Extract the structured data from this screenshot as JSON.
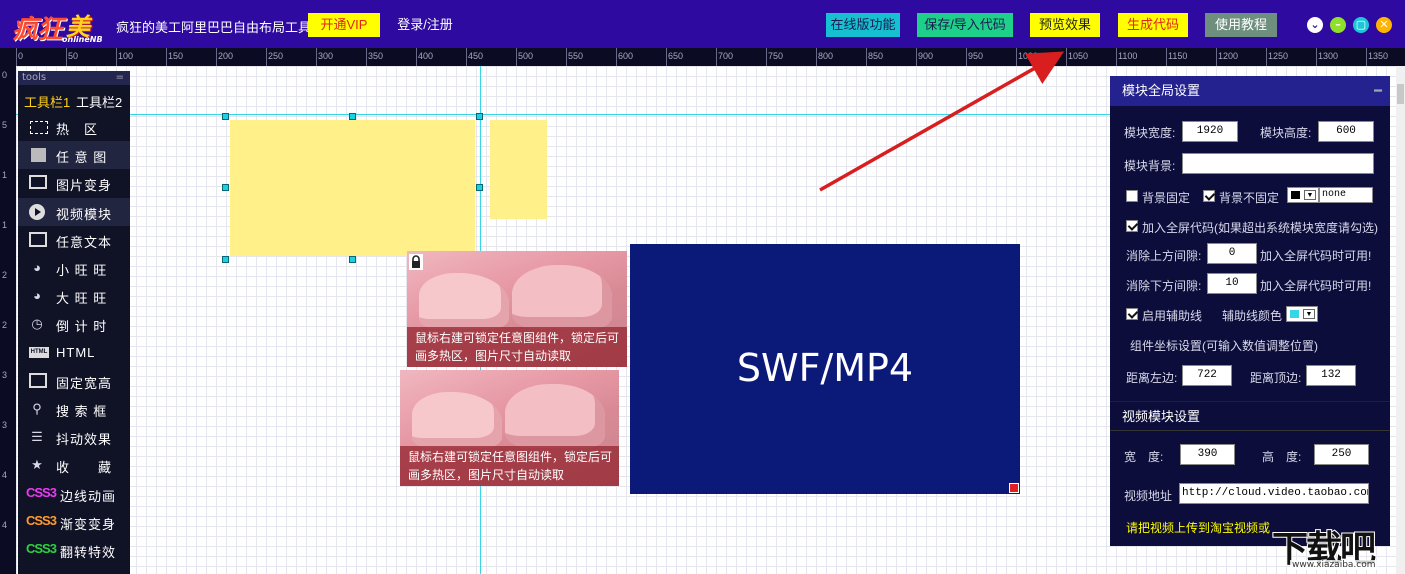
{
  "app": {
    "logo_main": "疯狂",
    "logo_accent": "美工",
    "logo_sub": "onlineNB",
    "title": "疯狂的美工阿里巴巴自由布局工具"
  },
  "toolbar": {
    "vip": "开通VIP",
    "login": "登录/注册",
    "online": "在线版功能",
    "save": "保存/导入代码",
    "preview": "预览效果",
    "generate": "生成代码",
    "help": "使用教程"
  },
  "window_controls": {
    "menu": "⌄",
    "minimize": "–",
    "maximize": "▢",
    "close": "✕"
  },
  "ruler": {
    "top_labels": [
      "0",
      "50",
      "100",
      "150",
      "200",
      "250",
      "300",
      "350",
      "400",
      "450",
      "500",
      "550",
      "600",
      "650",
      "700",
      "750",
      "800",
      "850",
      "900",
      "950",
      "1000",
      "1050",
      "1100",
      "1150",
      "1200",
      "1250",
      "1300",
      "1350"
    ],
    "left_labels": [
      "0",
      "5",
      "1",
      "1",
      "2",
      "2",
      "3",
      "3",
      "4",
      "4"
    ]
  },
  "tools": {
    "header": "tools",
    "collapse": "=",
    "tabs": [
      "工具栏1",
      "工具栏2"
    ],
    "items": [
      {
        "label": "热　区",
        "icon": "dashed-rect-icon"
      },
      {
        "label": "任 意 图",
        "icon": "square-icon"
      },
      {
        "label": "图片变身",
        "icon": "image-icon"
      },
      {
        "label": "视频模块",
        "icon": "play-icon"
      },
      {
        "label": "任意文本",
        "icon": "text-icon"
      },
      {
        "label": "小 旺 旺",
        "icon": "wangwang-icon"
      },
      {
        "label": "大 旺 旺",
        "icon": "wangwang-icon"
      },
      {
        "label": "倒 计 时",
        "icon": "timer-icon"
      },
      {
        "label": "HTML",
        "icon": "html-icon"
      },
      {
        "label": "固定宽高",
        "icon": "frame-icon"
      },
      {
        "label": "搜 索 框",
        "icon": "search-icon"
      },
      {
        "label": "抖动效果",
        "icon": "shake-icon"
      },
      {
        "label": "收　　藏",
        "icon": "star-icon"
      },
      {
        "label": "边线动画",
        "icon": "css3-icon"
      },
      {
        "label": "渐变变身",
        "icon": "css3-icon"
      },
      {
        "label": "翻转特效",
        "icon": "css3-icon"
      }
    ],
    "css3_badge": "CSS3"
  },
  "canvas": {
    "image_caption": "鼠标右建可锁定任意图组件，锁定后可画多热区，图片尺寸自动读取",
    "video_label": "SWF/MP4"
  },
  "global_settings": {
    "title": "模块全局设置",
    "width_label": "模块宽度:",
    "width_value": "1920",
    "height_label": "模块高度:",
    "height_value": "600",
    "bg_label": "模块背景:",
    "bg_value": "",
    "bg_fixed_label": "背景固定",
    "bg_fixed_checked": false,
    "bg_unfixed_label": "背景不固定",
    "bg_unfixed_checked": true,
    "bg_color_value": "none",
    "fullscreen_label": "加入全屏代码(如果超出系统模块宽度请勾选)",
    "fullscreen_checked": true,
    "top_gap_label": "消除上方间隙:",
    "top_gap_value": "0",
    "top_gap_note": "加入全屏代码时可用!",
    "bottom_gap_label": "消除下方间隙:",
    "bottom_gap_value": "10",
    "bottom_gap_note": "加入全屏代码时可用!",
    "aux_line_label": "启用辅助线",
    "aux_line_checked": true,
    "aux_color_label": "辅助线颜色",
    "aux_color": "#36d6e6",
    "coord_label": "组件坐标设置(可输入数值调整位置)",
    "left_label": "距离左边:",
    "left_value": "722",
    "top_label": "距离顶边:",
    "top_value": "132"
  },
  "video_settings": {
    "title": "视频模块设置",
    "width_label": "宽　度:",
    "width_value": "390",
    "height_label": "高　度:",
    "height_value": "250",
    "url_label": "视频地址",
    "url_value": "http://cloud.video.taobao.com//p",
    "tip": "请把视频上传到淘宝视频或"
  },
  "watermark": {
    "text": "下载吧",
    "url": "www.xiazaiba.com"
  },
  "colors": {
    "topbar": "#2e0aa0",
    "guide": "#36d6e6",
    "video_bg": "#0b1a78",
    "arrow": "#d81e1e"
  }
}
